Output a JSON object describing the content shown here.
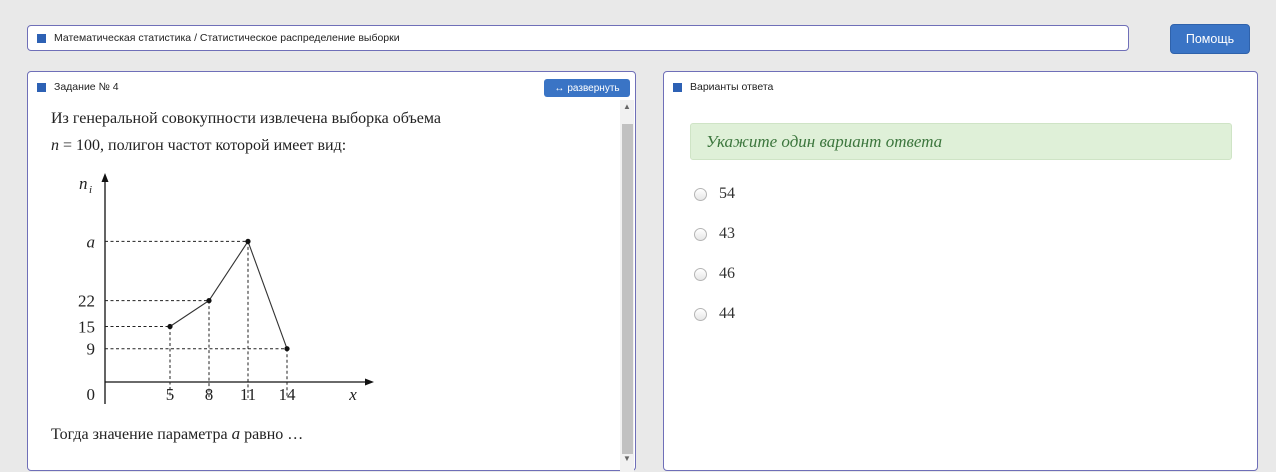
{
  "breadcrumb": {
    "text": "Математическая статистика / Статистическое распределение выборки"
  },
  "help_button": {
    "label": "Помощь"
  },
  "task_panel": {
    "title": "Задание № 4",
    "expand_label": "развернуть",
    "line1": "Из генеральной совокупности извлечена выборка объема",
    "n_var": "n",
    "n_eq": " = 100,",
    "line2_rest": " полигон частот которой имеет вид:",
    "question_prefix": "Тогда значение параметра ",
    "question_var": "a",
    "question_suffix": " равно …"
  },
  "answer_panel": {
    "title": "Варианты ответа",
    "hint": "Укажите один вариант ответа",
    "options": [
      "54",
      "43",
      "46",
      "44"
    ]
  },
  "colors": {
    "accent": "#3a74c5",
    "panel_border": "#6f6fb8",
    "hint_bg": "#dff0d8",
    "hint_text": "#3c763d"
  },
  "chart_data": {
    "type": "line",
    "ylabel": "n_i",
    "xlabel": "x",
    "origin_label": "0",
    "x_ticks": [
      "5",
      "8",
      "11",
      "14"
    ],
    "y_ticks": [
      "9",
      "15",
      "22",
      "a"
    ],
    "x": [
      5,
      8,
      11,
      14
    ],
    "y_labels": [
      "15",
      "22",
      "a",
      "9"
    ],
    "y_numeric_known": [
      15,
      22,
      null,
      9
    ],
    "dashed_guides": true
  }
}
